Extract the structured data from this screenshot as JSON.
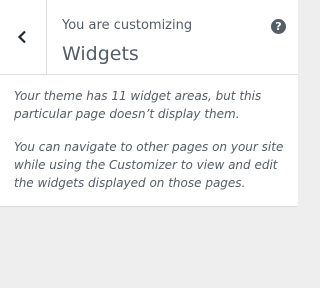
{
  "header": {
    "back_icon": "chevron-left-icon",
    "pre_title": "You are customizing",
    "title": "Widgets",
    "help_icon": "question-mark-icon",
    "help_glyph": "?"
  },
  "notice": {
    "paragraph1": "Your theme has 11 widget areas, but this particular page doesn’t display them.",
    "paragraph2": "You can navigate to other pages on your site while using the Customizer to view and edit the widgets displayed on those pages."
  }
}
